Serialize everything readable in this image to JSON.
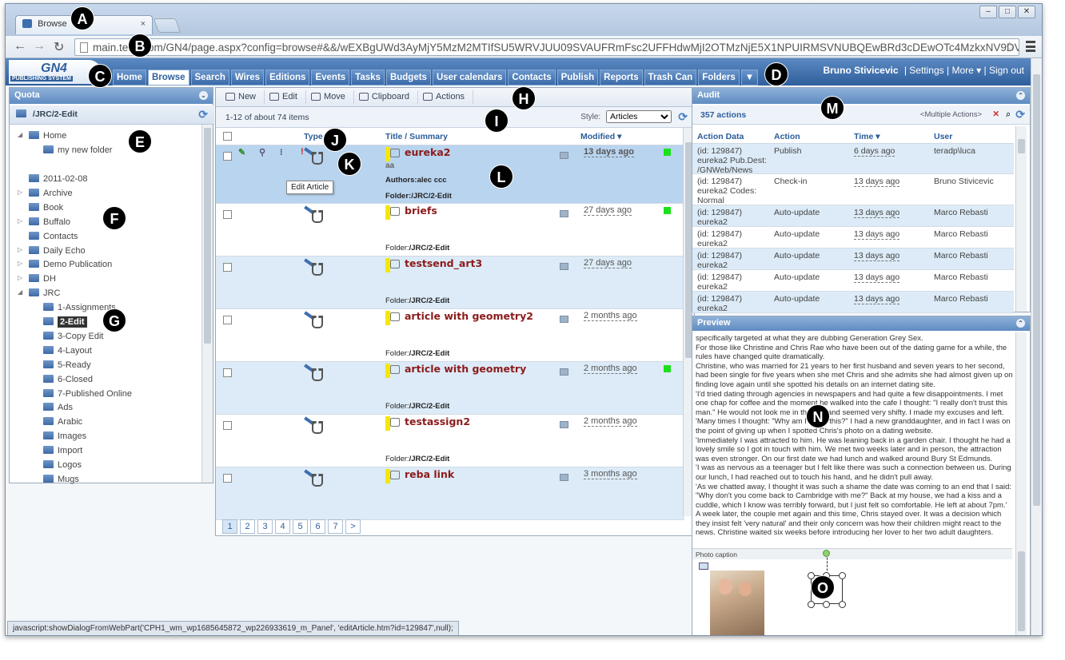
{
  "browser": {
    "tab_title": "Browse",
    "url": "main.teris.com/GN4/page.aspx?config=browse#&&/wEXBgUWd3AyMjY5MzM2MTIfSU5WRVJUU09SVAUFRmFsc2UFFHdwMjI2OTMzNjE5X1NPUIRMSVNUBQEwBRd3cDEwOTc4MzkxNV9DV"
  },
  "app": {
    "logo_text": "GN4",
    "logo_subtext": "PUBLISHING SYSTEM",
    "nav": [
      "Home",
      "Browse",
      "Search",
      "Wires",
      "Editions",
      "Events",
      "Tasks",
      "Budgets",
      "User calendars",
      "Contacts",
      "Publish",
      "Reports",
      "Trash Can",
      "Folders",
      "▼"
    ],
    "active_nav": "Browse",
    "user": {
      "name": "Bruno Stivicevic",
      "settings": "Settings",
      "more": "More",
      "signout": "Sign out"
    }
  },
  "left_panel": {
    "title": "Quota",
    "path": "/JRC/2-Edit",
    "home_items": [
      "Home",
      "my new folder"
    ],
    "folders": [
      "2011-02-08",
      "Archive",
      "Book",
      "Buffalo",
      "Contacts",
      "Daily Echo",
      "Demo Publication",
      "DH",
      "JRC"
    ],
    "jrc_children": [
      "1-Assignments",
      "2-Edit",
      "3-Copy Edit",
      "4-Layout",
      "5-Ready",
      "6-Closed",
      "7-Published Online",
      "Ads",
      "Arabic",
      "Images",
      "Import",
      "Logos",
      "Mugs"
    ],
    "selected": "2-Edit"
  },
  "actions": [
    "New",
    "Edit",
    "Move",
    "Clipboard",
    "Actions"
  ],
  "list": {
    "count": "1-12 of about 74 items",
    "style_label": "Style:",
    "style_value": "Articles",
    "col_type": "Type",
    "col_title": "Title / Summary",
    "col_modified": "Modified",
    "rows": [
      {
        "title": "eureka2",
        "summary": "aa",
        "authors_label": "Authors:",
        "authors": "alec ccc",
        "folder_label": "Folder:",
        "folder": "/JRC/2-Edit",
        "modified": "13 days ago"
      },
      {
        "title": "briefs",
        "folder_label": "Folder:",
        "folder": "/JRC/2-Edit",
        "modified": "27 days ago"
      },
      {
        "title": "testsend_art3",
        "folder_label": "Folder:",
        "folder": "/JRC/2-Edit",
        "modified": "27 days ago"
      },
      {
        "title": "article with geometry2",
        "folder_label": "Folder:",
        "folder": "/JRC/2-Edit",
        "modified": "2 months ago"
      },
      {
        "title": "article with geometry",
        "folder_label": "Folder:",
        "folder": "/JRC/2-Edit",
        "modified": "2 months ago"
      },
      {
        "title": "testassign2",
        "folder_label": "Folder:",
        "folder": "/JRC/2-Edit",
        "modified": "2 months ago"
      },
      {
        "title": "reba link",
        "modified": "3 months ago"
      }
    ],
    "tooltip": "Edit Article",
    "pages": [
      "1",
      "2",
      "3",
      "4",
      "5",
      "6",
      "7",
      ">"
    ]
  },
  "audit": {
    "title": "Audit",
    "count": "357 actions",
    "filter": "<Multiple Actions>",
    "cols": [
      "Action Data",
      "Action",
      "Time",
      "User"
    ],
    "rows": [
      {
        "data": "(id: 129847)\neureka2 Pub.Dest:\n/GNWeb/News",
        "action": "Publish",
        "time": "6 days ago",
        "user": "teradp\\luca"
      },
      {
        "data": "(id: 129847)\neureka2 Codes:\nNormal",
        "action": "Check-in",
        "time": "13 days ago",
        "user": "Bruno Stivicevic"
      },
      {
        "data": "(id: 129847)\neureka2",
        "action": "Auto-update",
        "time": "13 days ago",
        "user": "Marco Rebasti"
      },
      {
        "data": "(id: 129847)\neureka2",
        "action": "Auto-update",
        "time": "13 days ago",
        "user": "Marco Rebasti"
      },
      {
        "data": "(id: 129847)\neureka2",
        "action": "Auto-update",
        "time": "13 days ago",
        "user": "Marco Rebasti"
      },
      {
        "data": "(id: 129847)\neureka2",
        "action": "Auto-update",
        "time": "13 days ago",
        "user": "Marco Rebasti"
      },
      {
        "data": "(id: 129847)\neureka2",
        "action": "Auto-update",
        "time": "13 days ago",
        "user": "Marco Rebasti"
      }
    ]
  },
  "preview": {
    "title": "Preview",
    "text": "specifically targeted at what they are dubbing Generation Grey Sex.\nFor those like Christine and Chris Rae who have been out of the dating game for a while, the rules have changed quite dramatically.\nChristine, who was married for 21 years to her first husband and seven years to her second, had been single for five years when she met Chris and she admits she had almost given up on finding love again until she spotted his details on an internet dating site.\n'I'd tried dating through agencies in newspapers and had quite a few disappointments. I met one chap for coffee and the moment he walked into the cafe I thought: \"I really don't trust this man.\" He would not look me in the eye and seemed very shifty. I made my excuses and left.\n'Many times I thought: \"Why am I doing this?\" I had a new granddaughter, and in fact I was on the point of giving up when I spotted Chris's photo on a dating website.\n'Immediately I was attracted to him. He was leaning back in a garden chair. I thought he had a lovely smile so I got in touch with him. We met two weeks later and in person, the attraction was even stronger. On our first date we had lunch and walked around Bury St Edmunds.\n'I was as nervous as a teenager but I felt like there was such a connection between us. During our lunch, I had reached out to touch his hand, and he didn't pull away.\n'As we chatted away, I thought it was such a shame the date was coming to an end that I said: \"Why don't you come back to Cambridge with me?\" Back at my house, we had a kiss and a cuddle, which I know was terribly forward, but I just felt so comfortable. He left at about 7pm.'\nA week later, the couple met again and this time, Chris stayed over. It was a decision which they insist felt 'very natural' and their only concern was how their children might react to the news. Christine waited six weeks before introducing her lover to her two adult daughters.",
    "caption": "Photo caption"
  },
  "statusbar": "javascript:showDialogFromWebPart('CPH1_wm_wp1685645872_wp226933619_m_Panel', 'editArticle.htm?id=129847',null);",
  "markers": [
    "A",
    "B",
    "C",
    "D",
    "E",
    "F",
    "G",
    "H",
    "I",
    "J",
    "K",
    "L",
    "M",
    "N",
    "O"
  ],
  "colors": {
    "nav_bg": "#2f5f9c",
    "title_red": "#8c1b1b",
    "row_alt": "#dcebf7",
    "status_green": "#1de01d"
  }
}
